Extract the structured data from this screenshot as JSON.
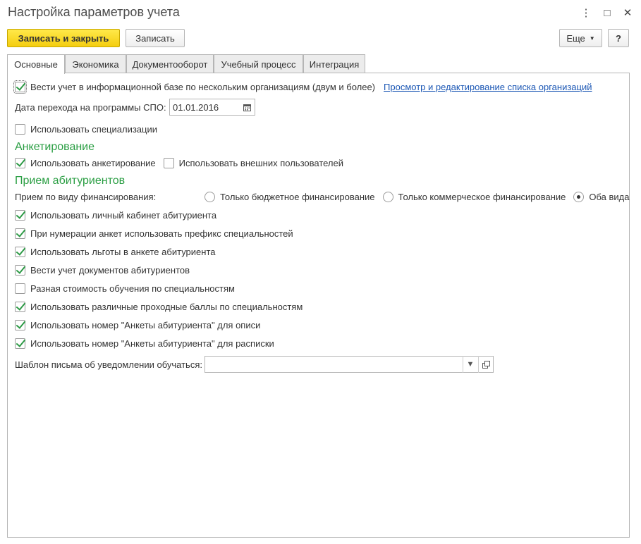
{
  "window": {
    "title": "Настройка параметров учета",
    "more_icon": "⋮",
    "maximize_icon": "□",
    "close_icon": "✕"
  },
  "toolbar": {
    "save_close_label": "Записать и закрыть",
    "save_label": "Записать",
    "more_label": "Еще",
    "help_label": "?"
  },
  "tabs": [
    {
      "label": "Основные",
      "active": true
    },
    {
      "label": "Экономика",
      "active": false
    },
    {
      "label": "Документооборот",
      "active": false
    },
    {
      "label": "Учебный процесс",
      "active": false
    },
    {
      "label": "Интеграция",
      "active": false
    }
  ],
  "main": {
    "multi_org": {
      "label": "Вести учет в информационной базе по нескольким организациям (двум и более)",
      "checked": true
    },
    "org_link": "Просмотр и редактирование списка организаций",
    "spo_date": {
      "label": "Дата перехода на программы СПО:",
      "value": "01.01.2016"
    },
    "specializations": {
      "label": "Использовать специализации",
      "checked": false
    }
  },
  "survey": {
    "heading": "Анкетирование",
    "use_survey": {
      "label": "Использовать анкетирование",
      "checked": true
    },
    "external_users": {
      "label": "Использовать внешних пользователей",
      "checked": false
    }
  },
  "admission": {
    "heading": "Прием абитуриентов",
    "financing_label": "Прием по виду финансирования:",
    "financing_options": [
      {
        "label": "Только бюджетное финансирование",
        "selected": false
      },
      {
        "label": "Только коммерческое финансирование",
        "selected": false
      },
      {
        "label": "Оба вида",
        "selected": true
      }
    ],
    "options": [
      {
        "label": "Использовать личный кабинет абитуриента",
        "checked": true
      },
      {
        "label": "При нумерации анкет использовать префикс специальностей",
        "checked": true
      },
      {
        "label": "Использовать льготы в анкете абитуриента",
        "checked": true
      },
      {
        "label": "Вести учет документов абитуриентов",
        "checked": true
      },
      {
        "label": "Разная стоимость обучения по специальностям",
        "checked": false
      },
      {
        "label": "Использовать различные проходные баллы по специальностям",
        "checked": true
      },
      {
        "label": "Использовать номер \"Анкеты абитуриента\" для описи",
        "checked": true
      },
      {
        "label": "Использовать номер \"Анкеты абитуриента\" для расписки",
        "checked": true
      }
    ],
    "template": {
      "label": "Шаблон письма об уведомлении обучаться:",
      "value": ""
    }
  },
  "colors": {
    "accent": "#2a9e43",
    "primary_button": "#f4cd0f",
    "link": "#1a56b4"
  }
}
